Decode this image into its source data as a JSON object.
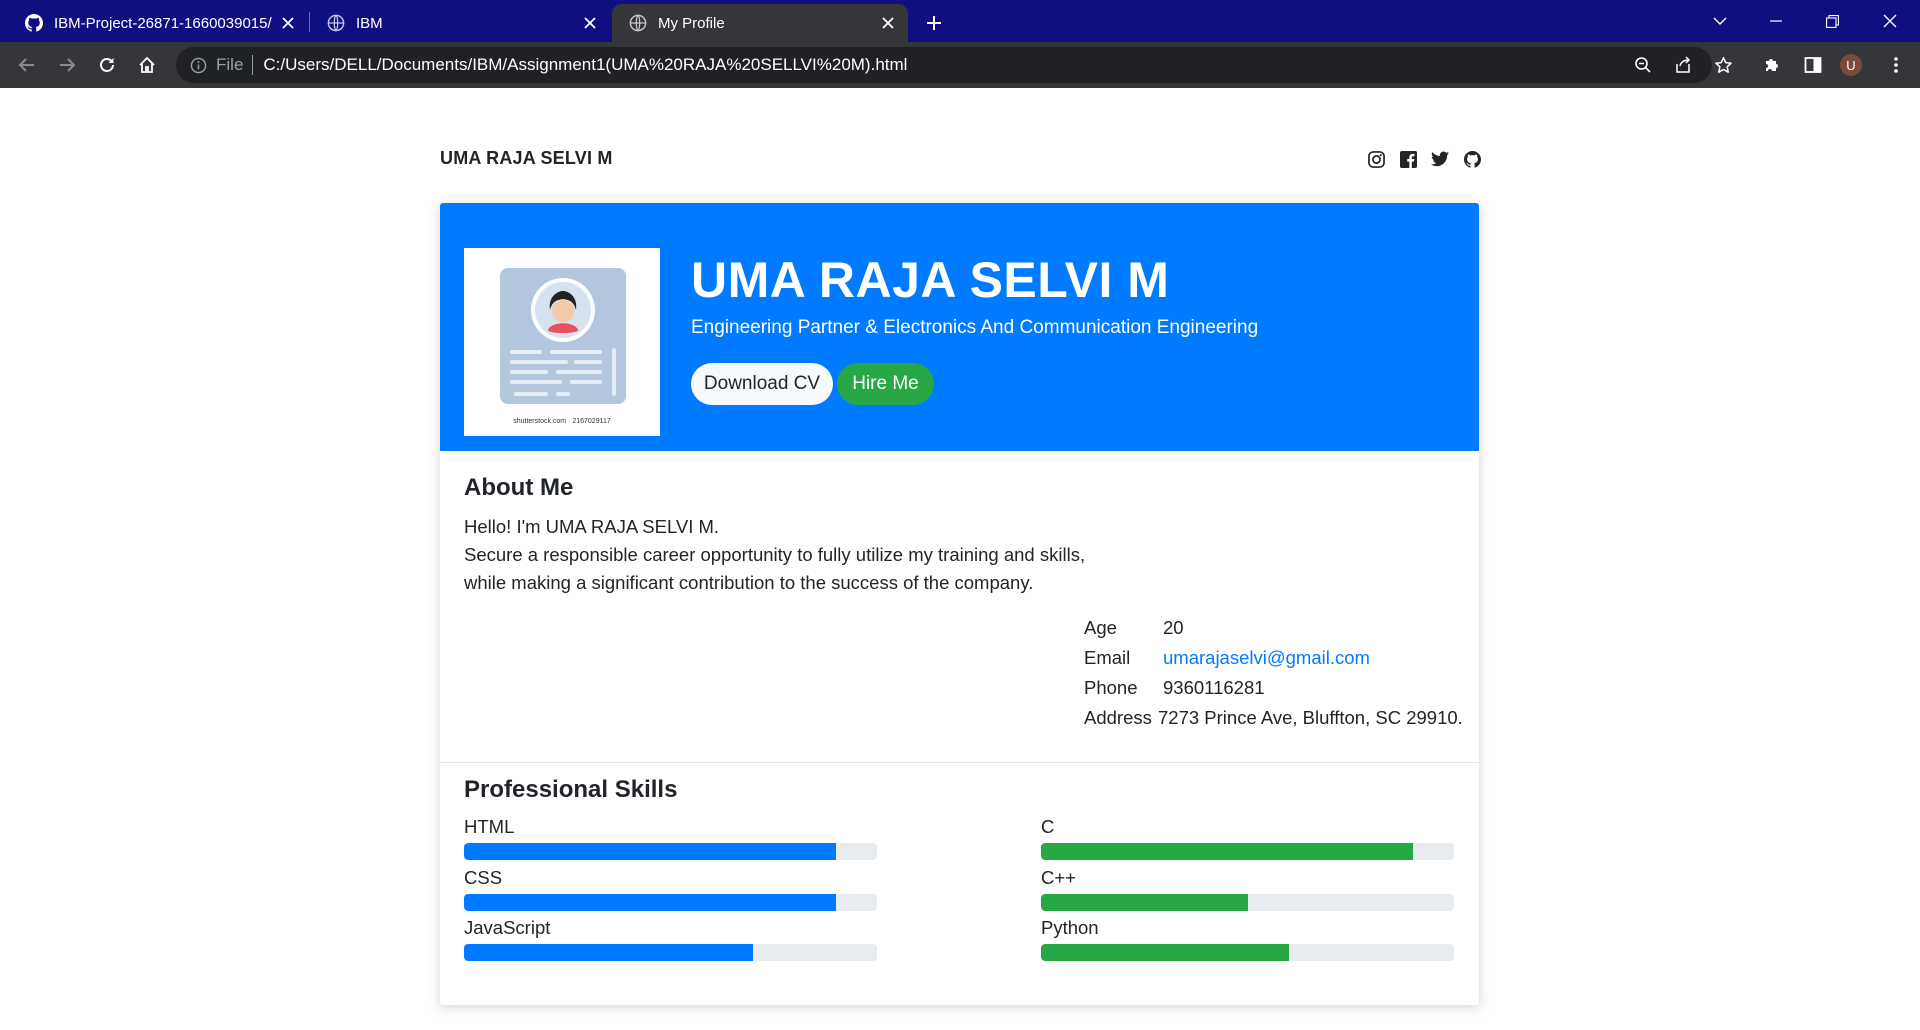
{
  "browser": {
    "tabs": [
      {
        "title": "IBM-Project-26871-1660039015/",
        "icon": "github-icon"
      },
      {
        "title": "IBM",
        "icon": "globe-icon"
      },
      {
        "title": "My Profile",
        "icon": "globe-icon",
        "active": true
      }
    ],
    "omnibox": {
      "scheme_label": "File",
      "url": "C:/Users/DELL/Documents/IBM/Assignment1(UMA%20RAJA%20SELLVI%20M).html"
    },
    "profile_initial": "U"
  },
  "page": {
    "brand": "UMA RAJA SELVI M",
    "social_icons": [
      "instagram-icon",
      "facebook-icon",
      "twitter-icon",
      "github-icon"
    ],
    "hero": {
      "name": "UMA RAJA SELVI M",
      "subtitle": "Engineering Partner & Electronics And Communication Engineering",
      "photo_caption": "shutterstock.com · 2167029117",
      "download_cv_label": "Download CV",
      "hire_me_label": "Hire Me"
    },
    "about": {
      "title": "About Me",
      "lines": [
        "Hello! I'm UMA RAJA SELVI M.",
        "Secure a responsible career opportunity to fully utilize my training and skills,",
        "while making a significant contribution to the success of the company."
      ],
      "info": [
        {
          "key": "Age",
          "value": "20"
        },
        {
          "key": "Email",
          "value": "umarajaselvi@gmail.com"
        },
        {
          "key": "Phone",
          "value": "9360116281"
        },
        {
          "key": "Address",
          "value": "7273 Prince Ave, Bluffton, SC 29910."
        }
      ]
    },
    "skills": {
      "title": "Professional Skills",
      "left": [
        {
          "name": "HTML",
          "percent": 90
        },
        {
          "name": "CSS",
          "percent": 90
        },
        {
          "name": "JavaScript",
          "percent": 70
        }
      ],
      "right": [
        {
          "name": "C",
          "percent": 90
        },
        {
          "name": "C++",
          "percent": 50
        },
        {
          "name": "Python",
          "percent": 60
        }
      ]
    },
    "colors": {
      "primary": "#007bff",
      "success": "#28a745",
      "track": "#e9ecef",
      "tabbar": "#0f0f82"
    }
  }
}
